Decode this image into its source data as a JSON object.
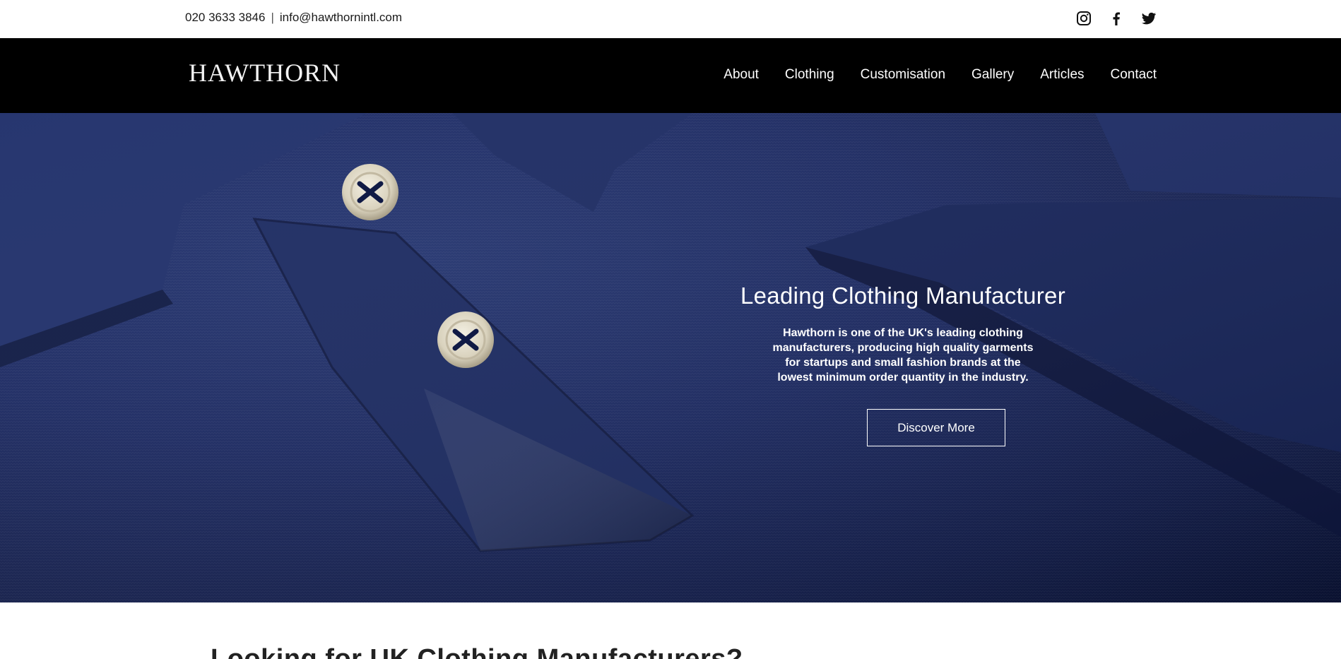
{
  "topbar": {
    "phone": "020 3633 3846",
    "separator": "|",
    "email": "info@hawthornintl.com",
    "socials": [
      "instagram-icon",
      "facebook-icon",
      "twitter-icon"
    ]
  },
  "nav": {
    "logo": "HAWTHORN",
    "items": [
      "About",
      "Clothing",
      "Customisation",
      "Gallery",
      "Articles",
      "Contact"
    ]
  },
  "hero": {
    "title": "Leading Clothing Manufacturer",
    "text": "Hawthorn is one of the UK's leading clothing manufacturers, producing high quality garments for startups and small fashion brands at the lowest minimum order quantity in the industry.",
    "button_label": "Discover More",
    "image_subject": "navy polo shirt with two buttons"
  },
  "section": {
    "heading": "Looking for UK Clothing Manufacturers?"
  },
  "colors": {
    "nav_bg": "#000000",
    "hero_bg": "#1a2862",
    "text_light": "#ffffff"
  }
}
